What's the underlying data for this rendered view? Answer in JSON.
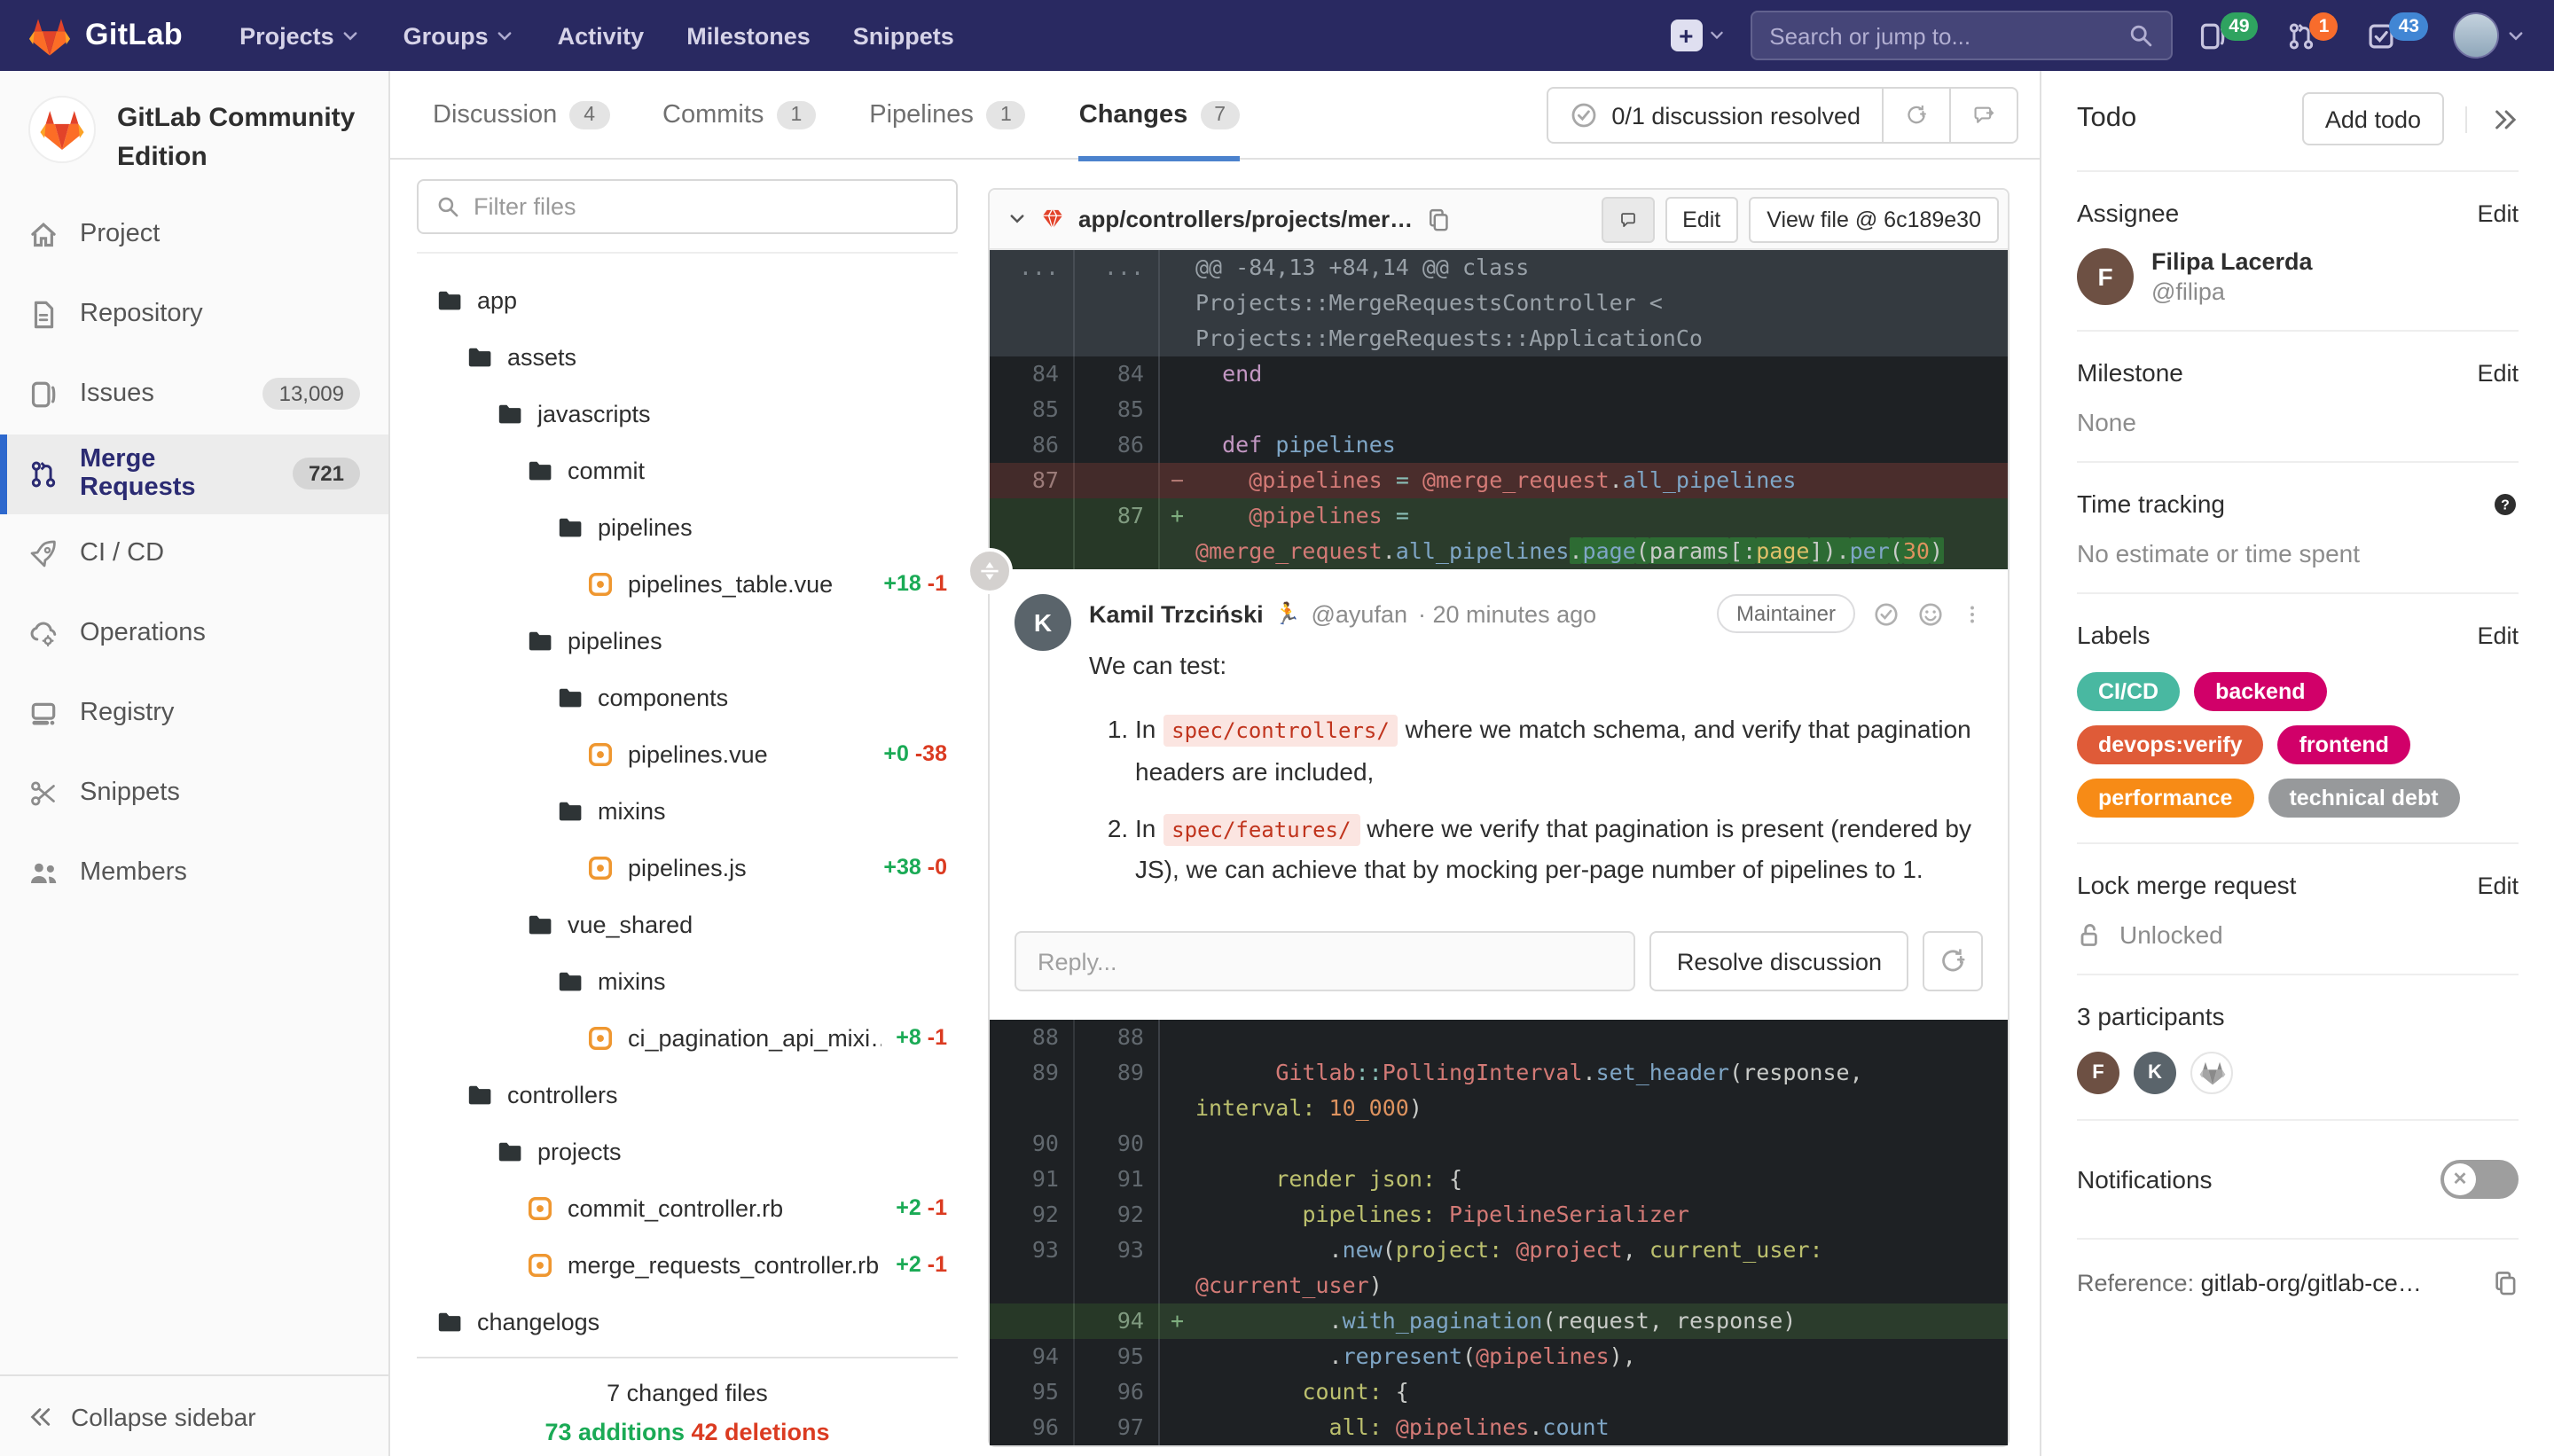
{
  "navbar": {
    "logo_text": "GitLab",
    "links": [
      {
        "label": "Projects",
        "dropdown": true
      },
      {
        "label": "Groups",
        "dropdown": true
      },
      {
        "label": "Activity",
        "dropdown": false
      },
      {
        "label": "Milestones",
        "dropdown": false
      },
      {
        "label": "Snippets",
        "dropdown": false
      }
    ],
    "search_placeholder": "Search or jump to...",
    "counters": [
      {
        "icon": "issues-icon",
        "count": "49",
        "color": "#2fa360"
      },
      {
        "icon": "merge-request-icon",
        "count": "1",
        "color": "#f86c2c"
      },
      {
        "icon": "todos-icon",
        "count": "43",
        "color": "#4186d4"
      }
    ]
  },
  "sidebar": {
    "project_title": "GitLab Community Edition",
    "items": [
      {
        "icon": "home-icon",
        "label": "Project"
      },
      {
        "icon": "document-icon",
        "label": "Repository"
      },
      {
        "icon": "issues-icon",
        "label": "Issues",
        "badge": "13,009"
      },
      {
        "icon": "merge-request-icon",
        "label": "Merge Requests",
        "badge": "721",
        "active": true
      },
      {
        "icon": "rocket-icon",
        "label": "CI / CD"
      },
      {
        "icon": "cloud-gear-icon",
        "label": "Operations"
      },
      {
        "icon": "container-icon",
        "label": "Registry"
      },
      {
        "icon": "scissors-icon",
        "label": "Snippets"
      },
      {
        "icon": "people-icon",
        "label": "Members"
      }
    ],
    "collapse_label": "Collapse sidebar"
  },
  "tabs": [
    {
      "label": "Discussion",
      "count": "4",
      "active": false
    },
    {
      "label": "Commits",
      "count": "1",
      "active": false
    },
    {
      "label": "Pipelines",
      "count": "1",
      "active": false
    },
    {
      "label": "Changes",
      "count": "7",
      "active": true
    }
  ],
  "resolved": {
    "label": "0/1 discussion resolved"
  },
  "file_panel": {
    "filter_placeholder": "Filter files",
    "tree": [
      {
        "type": "folder",
        "label": "app",
        "indent": 0
      },
      {
        "type": "folder",
        "label": "assets",
        "indent": 1
      },
      {
        "type": "folder",
        "label": "javascripts",
        "indent": 2
      },
      {
        "type": "folder",
        "label": "commit",
        "indent": 3
      },
      {
        "type": "folder",
        "label": "pipelines",
        "indent": 4
      },
      {
        "type": "file",
        "label": "pipelines_table.vue",
        "indent": 5,
        "added": "+18",
        "removed": "-1"
      },
      {
        "type": "folder",
        "label": "pipelines",
        "indent": 3
      },
      {
        "type": "folder",
        "label": "components",
        "indent": 4
      },
      {
        "type": "file",
        "label": "pipelines.vue",
        "indent": 5,
        "added": "+0",
        "removed": "-38"
      },
      {
        "type": "folder",
        "label": "mixins",
        "indent": 4
      },
      {
        "type": "file",
        "label": "pipelines.js",
        "indent": 5,
        "added": "+38",
        "removed": "-0"
      },
      {
        "type": "folder",
        "label": "vue_shared",
        "indent": 3
      },
      {
        "type": "folder",
        "label": "mixins",
        "indent": 4
      },
      {
        "type": "file",
        "label": "ci_pagination_api_mixi…",
        "indent": 5,
        "added": "+8",
        "removed": "-1"
      },
      {
        "type": "folder",
        "label": "controllers",
        "indent": 1
      },
      {
        "type": "folder",
        "label": "projects",
        "indent": 2
      },
      {
        "type": "file",
        "label": "commit_controller.rb",
        "indent": 3,
        "added": "+2",
        "removed": "-1"
      },
      {
        "type": "file",
        "label": "merge_requests_controller.rb",
        "indent": 3,
        "added": "+2",
        "removed": "-1"
      },
      {
        "type": "folder",
        "label": "changelogs",
        "indent": 0
      }
    ],
    "footer": {
      "files": "7 changed files",
      "additions": "73 additions",
      "deletions": "42 deletions"
    }
  },
  "diff": {
    "file_path": "app/controllers/projects/mer…",
    "edit_label": "Edit",
    "view_file_label": "View file @ 6c189e30",
    "block1": [
      {
        "type": "hunk",
        "old": "...",
        "new": "...",
        "segs": [
          {
            "t": "@@ -84,13 +84,14 @@ class Projects::MergeRequestsController < Projects::MergeRequests::ApplicationCo"
          }
        ]
      },
      {
        "type": "ctx",
        "old": "84",
        "new": "84",
        "segs": [
          {
            "t": "  "
          },
          {
            "t": "end",
            "c": "kw"
          }
        ]
      },
      {
        "type": "ctx",
        "old": "85",
        "new": "85",
        "segs": []
      },
      {
        "type": "ctx",
        "old": "86",
        "new": "86",
        "segs": [
          {
            "t": "  "
          },
          {
            "t": "def",
            "c": "kw"
          },
          {
            "t": " "
          },
          {
            "t": "pipelines",
            "c": "fn"
          }
        ]
      },
      {
        "type": "del",
        "old": "87",
        "new": "",
        "segs": [
          {
            "t": "    "
          },
          {
            "t": "@pipelines",
            "c": "var"
          },
          {
            "t": " "
          },
          {
            "t": "=",
            "c": "op"
          },
          {
            "t": " "
          },
          {
            "t": "@merge_request",
            "c": "var"
          },
          {
            "t": "."
          },
          {
            "t": "all_pipelines",
            "c": "fn"
          }
        ]
      },
      {
        "type": "add",
        "old": "",
        "new": "87",
        "segs": [
          {
            "t": "    "
          },
          {
            "t": "@pipelines",
            "c": "var"
          },
          {
            "t": " "
          },
          {
            "t": "=",
            "c": "op"
          },
          {
            "t": " "
          },
          {
            "t": "@merge_request",
            "c": "var"
          },
          {
            "t": "."
          },
          {
            "t": "all_pipelines",
            "c": "fn"
          },
          {
            "t": ".",
            "h": true
          },
          {
            "t": "page",
            "c": "fn",
            "h": true
          },
          {
            "t": "(",
            "h": true
          },
          {
            "t": "params",
            "h": true
          },
          {
            "t": "[:",
            "h": true
          },
          {
            "t": "page",
            "c": "sym",
            "h": true
          },
          {
            "t": "]).",
            "h": true
          },
          {
            "t": "per",
            "c": "fn",
            "h": true
          },
          {
            "t": "(",
            "h": true
          },
          {
            "t": "30",
            "c": "num",
            "h": true
          },
          {
            "t": ")",
            "h": true
          }
        ]
      }
    ],
    "block2": [
      {
        "type": "ctx",
        "old": "88",
        "new": "88",
        "segs": []
      },
      {
        "type": "ctx",
        "old": "89",
        "new": "89",
        "segs": [
          {
            "t": "      "
          },
          {
            "t": "Gitlab",
            "c": "var"
          },
          {
            "t": "::",
            "c": "op"
          },
          {
            "t": "PollingInterval",
            "c": "var"
          },
          {
            "t": "."
          },
          {
            "t": "set_header",
            "c": "fn"
          },
          {
            "t": "(response, "
          },
          {
            "t": "interval:",
            "c": "key"
          },
          {
            "t": " "
          },
          {
            "t": "10_000",
            "c": "num"
          },
          {
            "t": ")"
          }
        ]
      },
      {
        "type": "ctx",
        "old": "90",
        "new": "90",
        "segs": []
      },
      {
        "type": "ctx",
        "old": "91",
        "new": "91",
        "segs": [
          {
            "t": "      "
          },
          {
            "t": "render",
            "c": "key"
          },
          {
            "t": " "
          },
          {
            "t": "json:",
            "c": "key"
          },
          {
            "t": " {"
          }
        ]
      },
      {
        "type": "ctx",
        "old": "92",
        "new": "92",
        "segs": [
          {
            "t": "        "
          },
          {
            "t": "pipelines:",
            "c": "key"
          },
          {
            "t": " "
          },
          {
            "t": "PipelineSerializer",
            "c": "var"
          }
        ]
      },
      {
        "type": "ctx",
        "old": "93",
        "new": "93",
        "segs": [
          {
            "t": "          ."
          },
          {
            "t": "new",
            "c": "fn"
          },
          {
            "t": "("
          },
          {
            "t": "project:",
            "c": "key"
          },
          {
            "t": " "
          },
          {
            "t": "@project",
            "c": "var"
          },
          {
            "t": ", "
          },
          {
            "t": "current_user:",
            "c": "key"
          },
          {
            "t": " "
          },
          {
            "t": "@current_user",
            "c": "var"
          },
          {
            "t": ")"
          }
        ]
      },
      {
        "type": "add",
        "old": "",
        "new": "94",
        "segs": [
          {
            "t": "          ."
          },
          {
            "t": "with_pagination",
            "c": "fn"
          },
          {
            "t": "(request, response)"
          }
        ]
      },
      {
        "type": "ctx",
        "old": "94",
        "new": "95",
        "segs": [
          {
            "t": "          ."
          },
          {
            "t": "represent",
            "c": "fn"
          },
          {
            "t": "("
          },
          {
            "t": "@pipelines",
            "c": "var"
          },
          {
            "t": "),"
          }
        ]
      },
      {
        "type": "ctx",
        "old": "95",
        "new": "96",
        "segs": [
          {
            "t": "        "
          },
          {
            "t": "count:",
            "c": "key"
          },
          {
            "t": " {"
          }
        ]
      },
      {
        "type": "ctx",
        "old": "96",
        "new": "97",
        "segs": [
          {
            "t": "          "
          },
          {
            "t": "all:",
            "c": "key"
          },
          {
            "t": " "
          },
          {
            "t": "@pipelines",
            "c": "var"
          },
          {
            "t": "."
          },
          {
            "t": "count",
            "c": "fn"
          }
        ]
      }
    ]
  },
  "discussion": {
    "author": "Kamil Trzciński",
    "author_emoji": "🏃",
    "handle": "@ayufan",
    "time": "· 20 minutes ago",
    "role": "Maintainer",
    "intro": "We can test:",
    "list": [
      [
        {
          "t": "In "
        },
        {
          "t": "spec/controllers/",
          "code": true
        },
        {
          "t": " where we match schema, and verify that pagination headers are included,"
        }
      ],
      [
        {
          "t": "In "
        },
        {
          "t": "spec/features/",
          "code": true
        },
        {
          "t": " where we verify that pagination is present (rendered by JS), we can achieve that by mocking per-page number of pipelines to 1."
        }
      ]
    ],
    "reply_placeholder": "Reply...",
    "resolve_label": "Resolve discussion"
  },
  "right_sidebar": {
    "todo_label": "Todo",
    "add_todo_label": "Add todo",
    "assignee": {
      "title": "Assignee",
      "action": "Edit",
      "name": "Filipa Lacerda",
      "handle": "@filipa",
      "avatar_initial": "F",
      "avatar_color": "#6d5043"
    },
    "milestone": {
      "title": "Milestone",
      "action": "Edit",
      "value": "None"
    },
    "time_tracking": {
      "title": "Time tracking",
      "value": "No estimate or time spent"
    },
    "labels": {
      "title": "Labels",
      "action": "Edit",
      "pills": [
        {
          "text": "CI/CD",
          "color": "#49b8a1"
        },
        {
          "text": "backend",
          "color": "#d10069"
        },
        {
          "text": "devops:verify",
          "color": "#df5b38"
        },
        {
          "text": "frontend",
          "color": "#d10069"
        },
        {
          "text": "performance",
          "color": "#f78b16"
        },
        {
          "text": "technical debt",
          "color": "#97999b"
        }
      ]
    },
    "lock": {
      "title": "Lock merge request",
      "action": "Edit",
      "value": "Unlocked"
    },
    "participants": {
      "title": "3 participants",
      "avatars": [
        {
          "type": "initial",
          "text": "F",
          "color": "#6d5043"
        },
        {
          "type": "initial",
          "text": "K",
          "color": "#5a646b"
        },
        {
          "type": "tanuki"
        }
      ]
    },
    "notifications": {
      "title": "Notifications",
      "enabled": false
    },
    "reference": {
      "label": "Reference:",
      "value": "gitlab-org/gitlab-ce…"
    }
  }
}
